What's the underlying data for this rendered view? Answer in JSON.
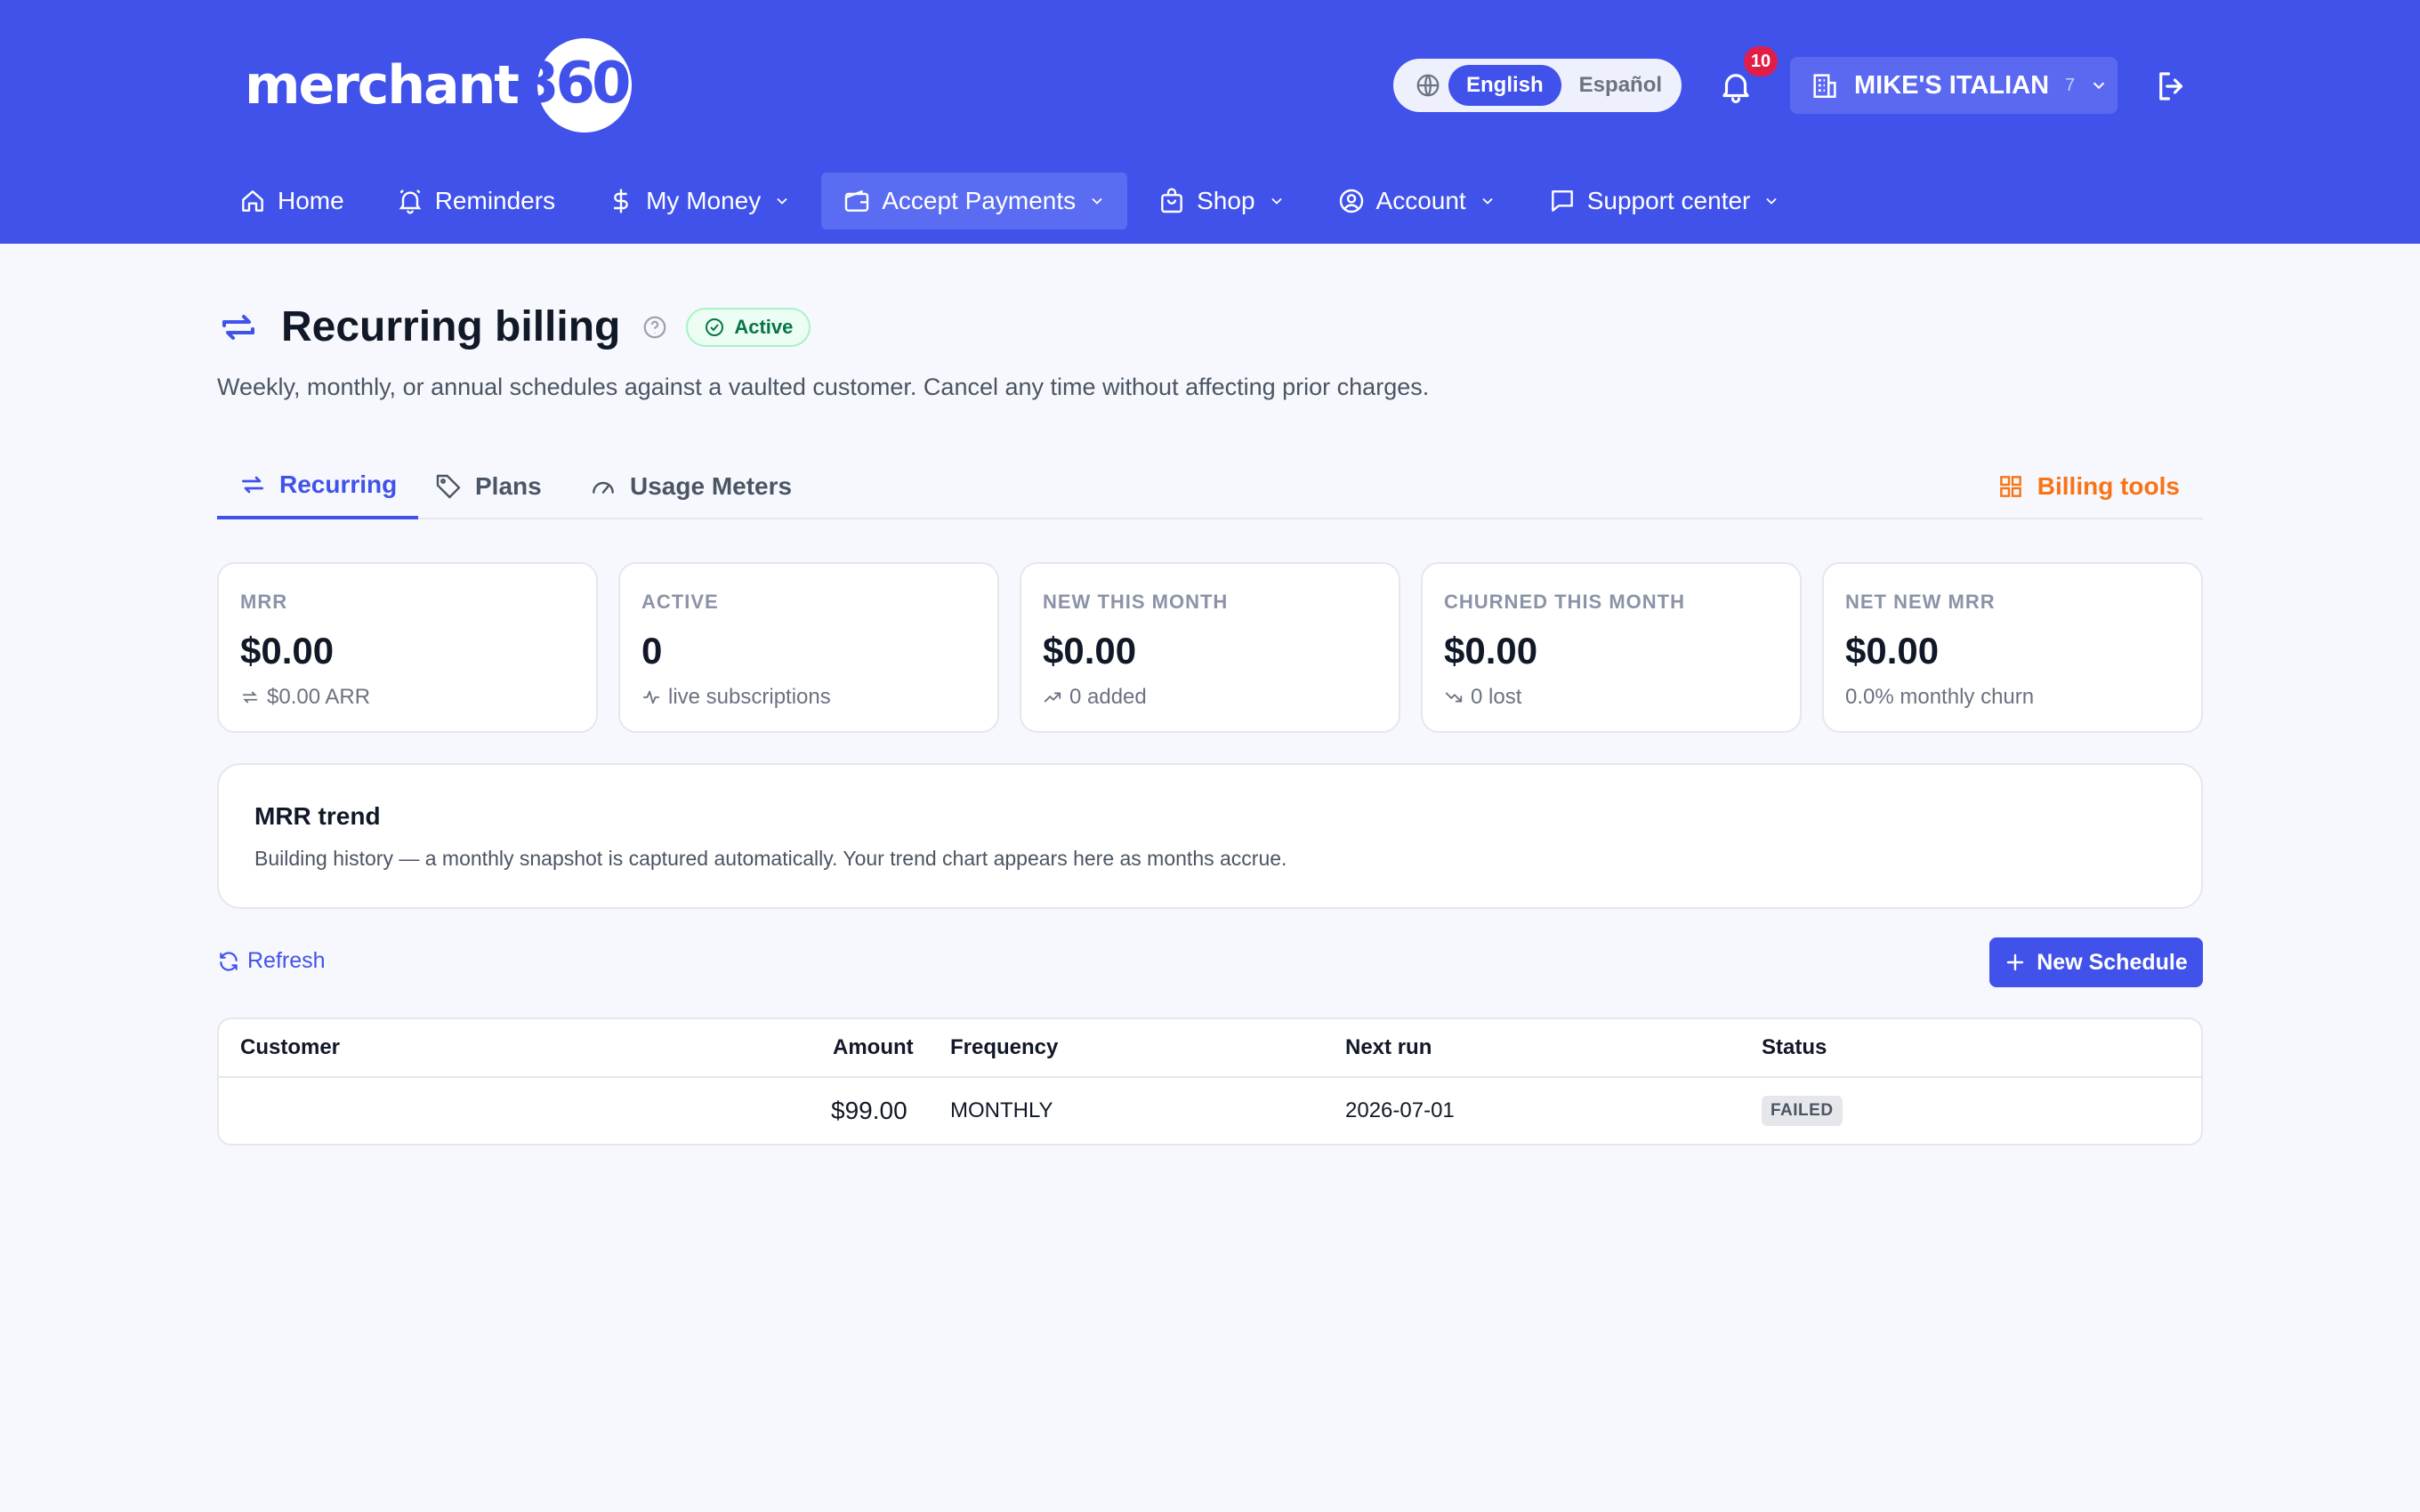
{
  "brand": {
    "logo_word": "merchant",
    "logo_num": "360"
  },
  "header": {
    "languages": [
      {
        "label": "English",
        "selected": true
      },
      {
        "label": "Español",
        "selected": false
      }
    ],
    "notification_count": "10",
    "merchant_name": "MIKE'S ITALIAN",
    "merchant_count": "7"
  },
  "nav": {
    "items": [
      {
        "label": "Home",
        "icon": "home-icon"
      },
      {
        "label": "Reminders",
        "icon": "bell-icon"
      },
      {
        "label": "My Money",
        "icon": "dollar-icon"
      },
      {
        "label": "Accept Payments",
        "icon": "wallet-icon"
      },
      {
        "label": "Shop",
        "icon": "shopping-bag-icon"
      },
      {
        "label": "Account",
        "icon": "user-circle-icon"
      },
      {
        "label": "Support center",
        "icon": "chat-icon"
      }
    ]
  },
  "page": {
    "title": "Recurring billing",
    "status": "Active",
    "subtitle": "Weekly, monthly, or annual schedules against a vaulted customer. Cancel any time without affecting prior charges."
  },
  "tabs": {
    "items": [
      {
        "label": "Recurring"
      },
      {
        "label": "Plans"
      },
      {
        "label": "Usage Meters"
      }
    ],
    "tools_label": "Billing tools"
  },
  "stats": [
    {
      "label": "MRR",
      "value": "$0.00",
      "sub": "$0.00 ARR"
    },
    {
      "label": "ACTIVE",
      "value": "0",
      "sub": "live subscriptions"
    },
    {
      "label": "NEW THIS MONTH",
      "value": "$0.00",
      "sub": "0 added"
    },
    {
      "label": "CHURNED THIS MONTH",
      "value": "$0.00",
      "sub": "0 lost"
    },
    {
      "label": "NET NEW MRR",
      "value": "$0.00",
      "sub": "0.0% monthly churn"
    }
  ],
  "trend": {
    "title": "MRR trend",
    "text": "Building history — a monthly snapshot is captured automatically. Your trend chart appears here as months accrue."
  },
  "actions": {
    "refresh_label": "Refresh",
    "new_schedule_label": "New Schedule"
  },
  "table": {
    "columns": [
      "Customer",
      "Amount",
      "Frequency",
      "Next run",
      "Status"
    ],
    "rows": [
      {
        "customer": "",
        "amount": "$99.00",
        "frequency": "MONTHLY",
        "next_run": "2026-07-01",
        "status": "FAILED"
      }
    ]
  },
  "colors": {
    "primary": "#4152eb",
    "accent": "#f97316",
    "success": "#067647",
    "danger": "#e11d48"
  }
}
